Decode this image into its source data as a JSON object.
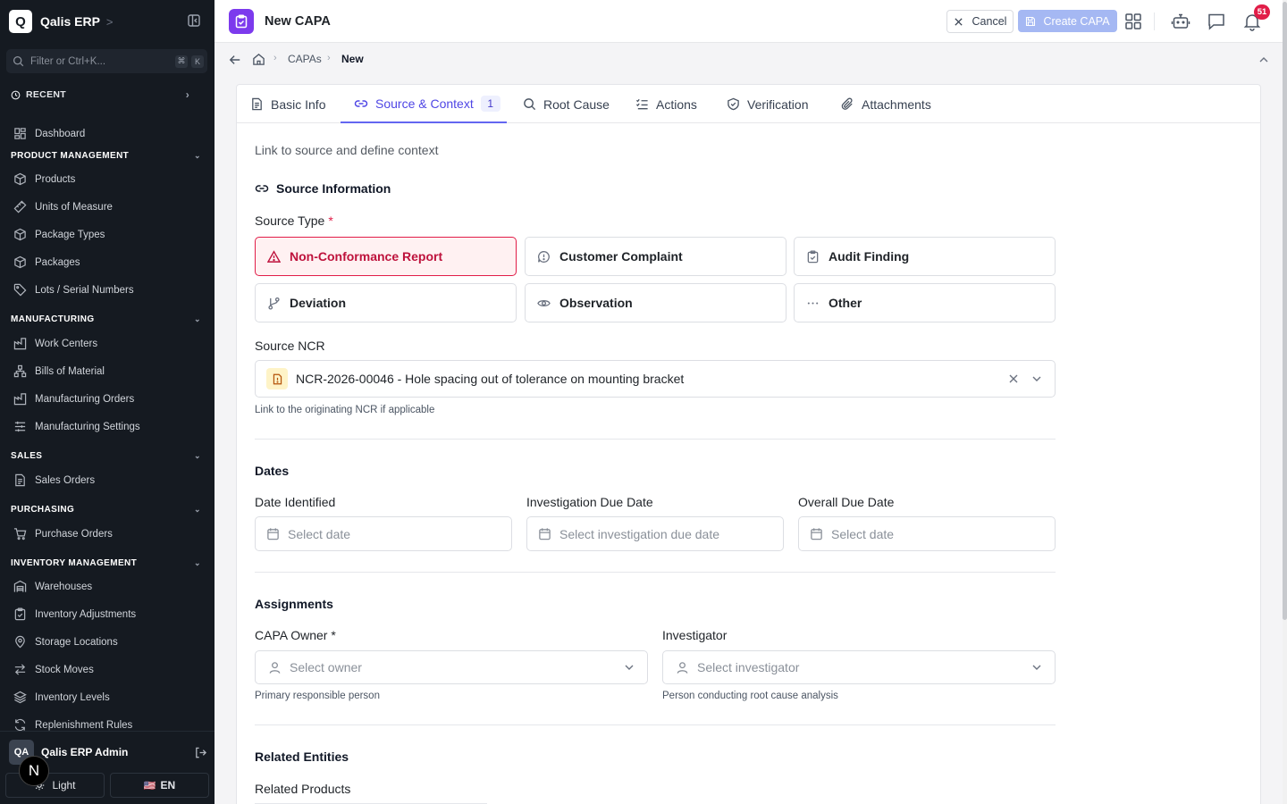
{
  "sidebar": {
    "brand_letter": "Q",
    "brand_name": "Qalis ERP",
    "brand_chevron": ">",
    "filter_placeholder": "Filter or Ctrl+K...",
    "filter_keys": [
      "⌘",
      "K"
    ],
    "recent_label": "RECENT",
    "recent_chevron": "›",
    "dashboard": "Dashboard",
    "sections": {
      "product": "PRODUCT MANAGEMENT",
      "manufacturing": "MANUFACTURING",
      "sales": "SALES",
      "purchasing": "PURCHASING",
      "inventory": "INVENTORY MANAGEMENT"
    },
    "items": {
      "products": "Products",
      "uom": "Units of Measure",
      "package_types": "Package Types",
      "packages": "Packages",
      "lots": "Lots / Serial Numbers",
      "work_centers": "Work Centers",
      "boms": "Bills of Material",
      "mos": "Manufacturing Orders",
      "mfg_settings": "Manufacturing Settings",
      "sales_orders": "Sales Orders",
      "purchase_orders": "Purchase Orders",
      "warehouses": "Warehouses",
      "inv_adjust": "Inventory Adjustments",
      "storage": "Storage Locations",
      "stock_moves": "Stock Moves",
      "inv_levels": "Inventory Levels",
      "replenish": "Replenishment Rules"
    },
    "user_initials": "QA",
    "user_name": "Qalis ERP Admin",
    "theme_label": "Light",
    "lang_flag": "🇺🇸",
    "lang_label": "EN",
    "next_badge": "N"
  },
  "topbar": {
    "title": "New CAPA",
    "cancel_label": "Cancel",
    "create_label": "Create CAPA",
    "notification_count": "51"
  },
  "breadcrumb": {
    "parent": "CAPAs",
    "current": "New",
    "sep": "›"
  },
  "tabs": [
    {
      "label": "Basic Info"
    },
    {
      "label": "Source & Context",
      "badge": "1"
    },
    {
      "label": "Root Cause"
    },
    {
      "label": "Actions"
    },
    {
      "label": "Verification"
    },
    {
      "label": "Attachments"
    }
  ],
  "form": {
    "subtitle": "Link to source and define context",
    "source_section": "Source Information",
    "source_type_label": "Source Type",
    "required_mark": "*",
    "source_types": [
      "Non-Conformance Report",
      "Customer Complaint",
      "Audit Finding",
      "Deviation",
      "Observation",
      "Other"
    ],
    "selected_source_type": "Non-Conformance Report",
    "source_ncr_label": "Source NCR",
    "source_ncr_value": "NCR-2026-00046 - Hole spacing out of tolerance on mounting bracket",
    "source_ncr_hint": "Link to the originating NCR if applicable",
    "dates_section": "Dates",
    "date_identified_label": "Date Identified",
    "date_identified_ph": "Select date",
    "inv_due_label": "Investigation Due Date",
    "inv_due_ph": "Select investigation due date",
    "overall_due_label": "Overall Due Date",
    "overall_due_ph": "Select date",
    "assign_section": "Assignments",
    "owner_label": "CAPA Owner *",
    "owner_ph": "Select owner",
    "owner_hint": "Primary responsible person",
    "investigator_label": "Investigator",
    "investigator_ph": "Select investigator",
    "investigator_hint": "Person conducting root cause analysis",
    "related_section": "Related Entities",
    "related_products_label": "Related Products"
  },
  "colors": {
    "accent": "#6366f1",
    "selected_border": "#e11d48",
    "sidebar_bg": "#151a21",
    "page_icon": "#7c3aed"
  },
  "icons": [
    "search-icon",
    "clock-icon",
    "grid-icon",
    "package-icon",
    "ruler-icon",
    "tag-icon",
    "factory-icon",
    "network-icon",
    "sliders-icon",
    "file-icon",
    "cart-icon",
    "warehouse-icon",
    "clipboard-icon",
    "map-pin-icon",
    "arrows-icon",
    "layers-icon",
    "refresh-icon",
    "logout-icon",
    "sun-icon",
    "close-icon",
    "save-icon",
    "apps-icon",
    "bot-icon",
    "chat-icon",
    "bell-icon",
    "arrow-left-icon",
    "home-icon",
    "chevron-up-icon",
    "link-icon",
    "alert-triangle-icon",
    "message-alert-icon",
    "clipboard-check-icon",
    "git-branch-icon",
    "eye-icon",
    "more-icon",
    "calendar-icon",
    "user-icon",
    "chevron-down-icon"
  ]
}
